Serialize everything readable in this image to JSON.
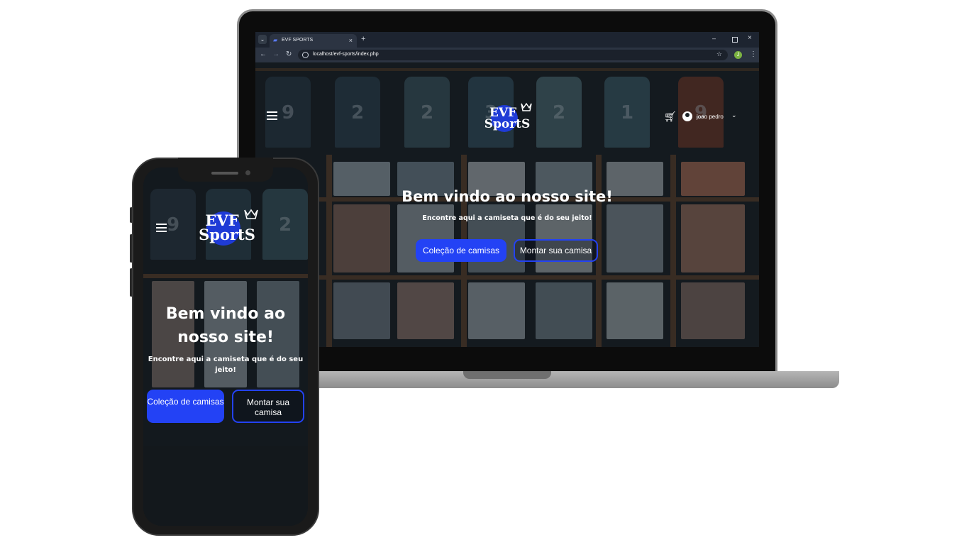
{
  "browser": {
    "tab_title": "EVF SPORTS",
    "tab_close": "×",
    "new_tab": "+",
    "url": "localhost/evf-sports/index.php",
    "profile_initial": "J",
    "window_min": "–",
    "window_close": "×"
  },
  "site": {
    "logo_text_top": "EVF",
    "logo_text_bottom": "SportS",
    "user_name": "joao pedro",
    "hero": {
      "title": "Bem vindo ao nosso site!",
      "subtitle": "Encontre aqui a camiseta que é do seu jeito!",
      "primary_button": "Coleção de camisas",
      "secondary_button": "Montar sua camisa"
    }
  },
  "phone": {
    "title": "Bem vindo ao nosso site!",
    "subtitle": "Encontre aqui a camiseta que é do seu jeito!",
    "primary_button": "Coleção de camisas",
    "secondary_button": "Montar sua camisa"
  },
  "colors": {
    "accent": "#2342f5",
    "browser_toolbar": "#2c3442",
    "browser_tabstrip": "#1d2430"
  },
  "icons": [
    "menu-icon",
    "cart-icon",
    "user-icon",
    "chevron-down-icon",
    "star-icon",
    "reload-icon",
    "back-icon",
    "forward-icon"
  ]
}
